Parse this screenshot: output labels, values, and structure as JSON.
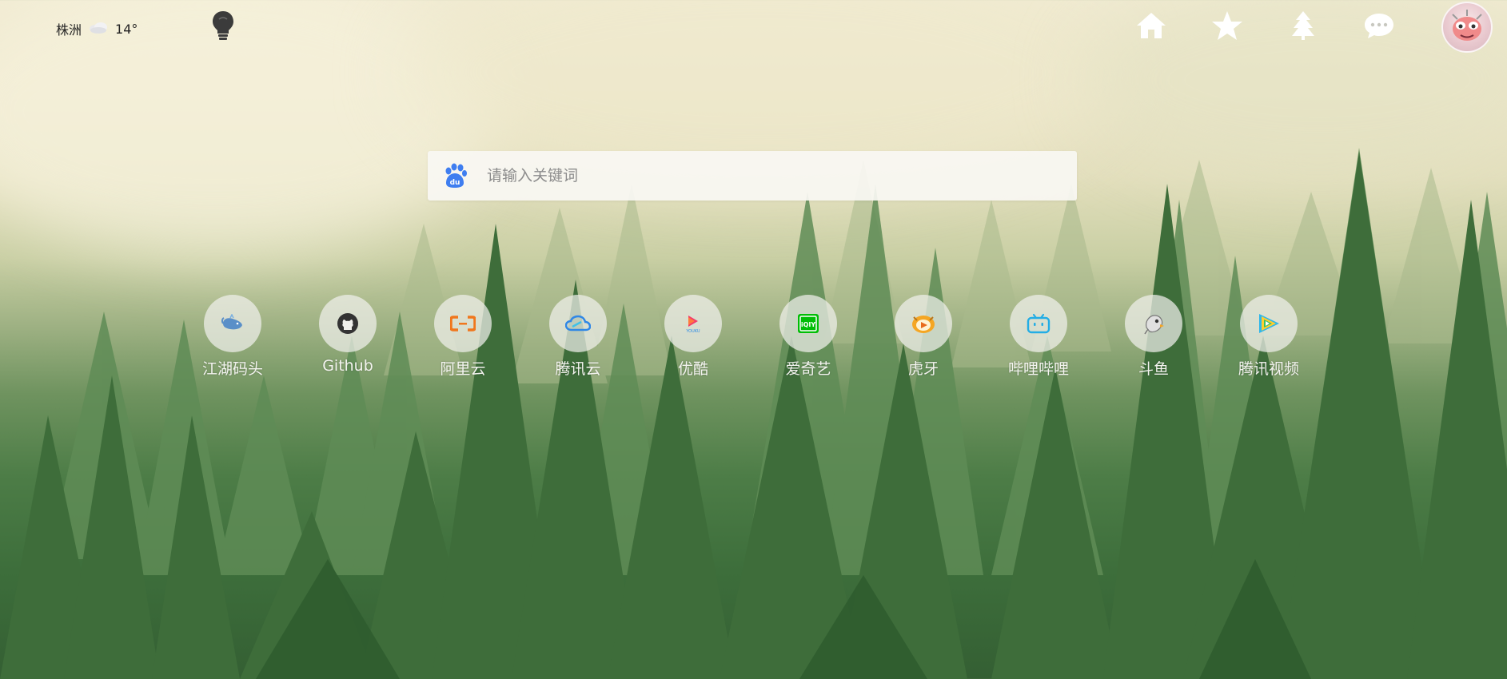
{
  "weather": {
    "city": "株洲",
    "temperature": "14°",
    "condition_icon": "cloud-icon"
  },
  "header": {
    "theme_toggle_icon": "lightbulb-icon",
    "nav_icons": [
      "home-icon",
      "star-icon",
      "tree-icon",
      "chat-icon"
    ],
    "avatar_icon": "avatar"
  },
  "search": {
    "engine_icon": "baidu-icon",
    "placeholder": "请输入关键词",
    "value": ""
  },
  "shortcuts": [
    {
      "label": "江湖码头",
      "icon": "whale-icon"
    },
    {
      "label": "Github",
      "icon": "github-icon"
    },
    {
      "label": "阿里云",
      "icon": "aliyun-icon"
    },
    {
      "label": "腾讯云",
      "icon": "tencent-cloud-icon"
    },
    {
      "label": "优酷",
      "icon": "youku-icon"
    },
    {
      "label": "爱奇艺",
      "icon": "iqiyi-icon"
    },
    {
      "label": "虎牙",
      "icon": "huya-icon"
    },
    {
      "label": "哔哩哔哩",
      "icon": "bilibili-icon"
    },
    {
      "label": "斗鱼",
      "icon": "douyu-icon"
    },
    {
      "label": "腾讯视频",
      "icon": "tencent-video-icon"
    }
  ],
  "colors": {
    "baidu_blue": "#3f7ef0",
    "aliyun_orange": "#f0771d",
    "tencent_cloud_blue": "#2f87e6",
    "youku_pink": "#f43c6a",
    "iqiyi_green": "#00be06",
    "huya_orange": "#f5a623",
    "bilibili_blue": "#23ade5",
    "label_white": "#f4f4f0"
  }
}
